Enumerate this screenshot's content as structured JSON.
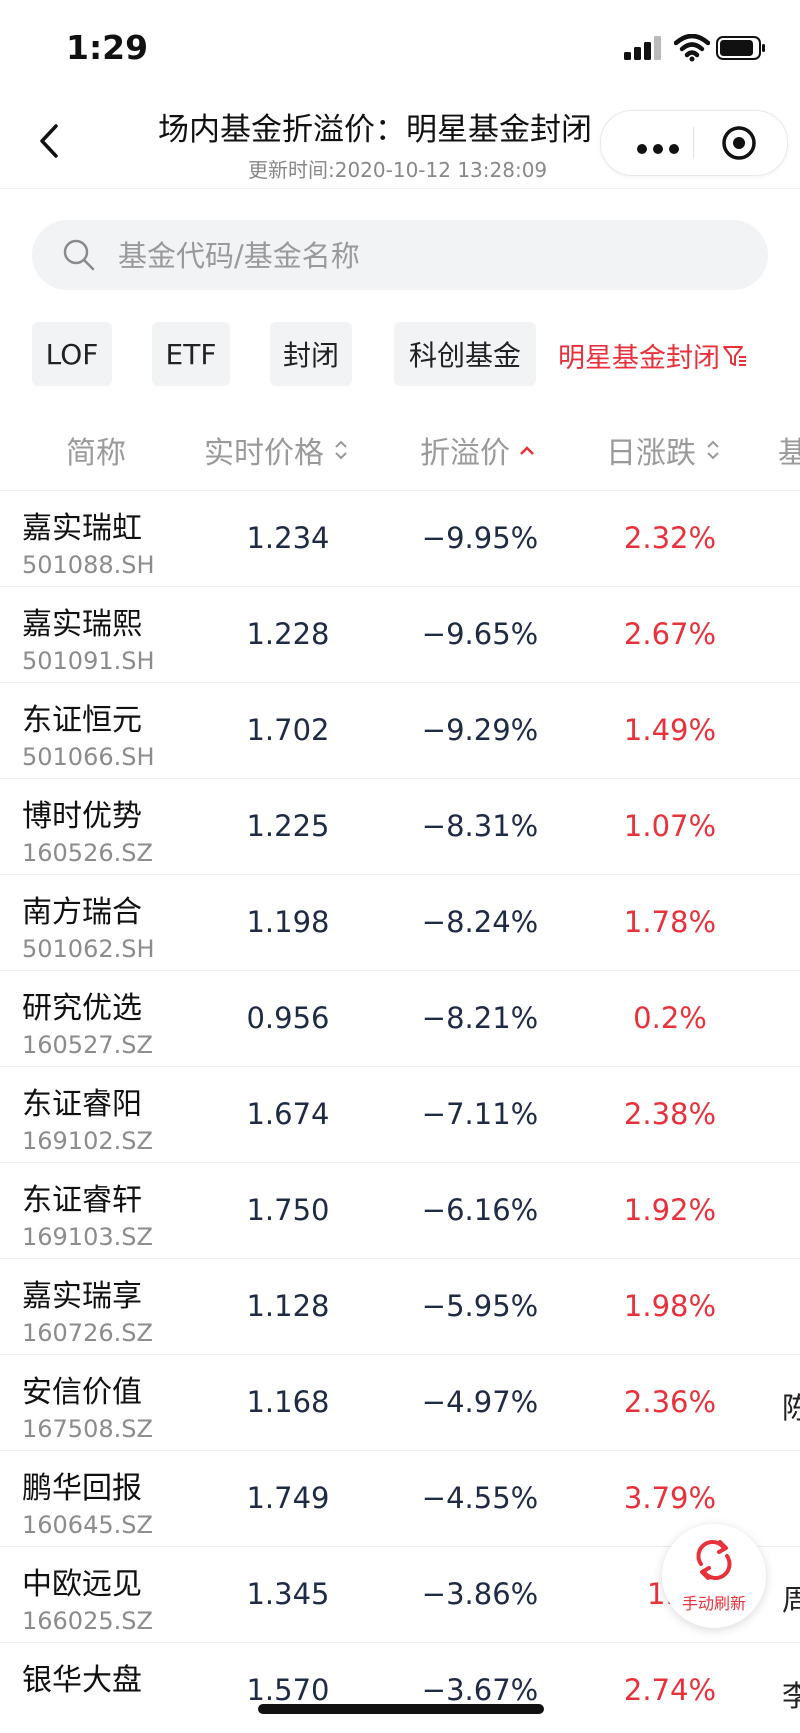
{
  "status": {
    "time": "1:29"
  },
  "nav": {
    "title": "场内基金折溢价：明星基金封闭",
    "subtitle": "更新时间:2020-10-12 13:28:09"
  },
  "search": {
    "placeholder": "基金代码/基金名称",
    "value": ""
  },
  "filters": {
    "chips": [
      "LOF",
      "ETF",
      "封闭",
      "科创基金"
    ],
    "active": "明星基金封闭"
  },
  "table": {
    "headers": [
      "简称",
      "实时价格",
      "折溢价",
      "日涨跌",
      "基"
    ],
    "rows": [
      {
        "name": "嘉实瑞虹",
        "code": "501088.SH",
        "price": "1.234",
        "premium": "−9.95%",
        "change": "2.32%",
        "extra": ""
      },
      {
        "name": "嘉实瑞熙",
        "code": "501091.SH",
        "price": "1.228",
        "premium": "−9.65%",
        "change": "2.67%",
        "extra": ""
      },
      {
        "name": "东证恒元",
        "code": "501066.SH",
        "price": "1.702",
        "premium": "−9.29%",
        "change": "1.49%",
        "extra": ""
      },
      {
        "name": "博时优势",
        "code": "160526.SZ",
        "price": "1.225",
        "premium": "−8.31%",
        "change": "1.07%",
        "extra": ""
      },
      {
        "name": "南方瑞合",
        "code": "501062.SH",
        "price": "1.198",
        "premium": "−8.24%",
        "change": "1.78%",
        "extra": ""
      },
      {
        "name": "研究优选",
        "code": "160527.SZ",
        "price": "0.956",
        "premium": "−8.21%",
        "change": "0.2%",
        "extra": ""
      },
      {
        "name": "东证睿阳",
        "code": "169102.SZ",
        "price": "1.674",
        "premium": "−7.11%",
        "change": "2.38%",
        "extra": ""
      },
      {
        "name": "东证睿轩",
        "code": "169103.SZ",
        "price": "1.750",
        "premium": "−6.16%",
        "change": "1.92%",
        "extra": ""
      },
      {
        "name": "嘉实瑞享",
        "code": "160726.SZ",
        "price": "1.128",
        "premium": "−5.95%",
        "change": "1.98%",
        "extra": ""
      },
      {
        "name": "安信价值",
        "code": "167508.SZ",
        "price": "1.168",
        "premium": "−4.97%",
        "change": "2.36%",
        "extra": "陈"
      },
      {
        "name": "鹏华回报",
        "code": "160645.SZ",
        "price": "1.749",
        "premium": "−4.55%",
        "change": "3.79%",
        "extra": ""
      },
      {
        "name": "中欧远见",
        "code": "166025.SZ",
        "price": "1.345",
        "premium": "−3.86%",
        "change": "1.5",
        "extra": "周"
      },
      {
        "name": "银华大盘",
        "code": "",
        "price": "1.570",
        "premium": "−3.67%",
        "change": "2.74%",
        "extra": "李"
      }
    ]
  },
  "refresh": {
    "label": "手动刷新"
  },
  "colors": {
    "accent": "#e8313b",
    "text": "#1f2a44",
    "muted": "#9a9a9a"
  }
}
